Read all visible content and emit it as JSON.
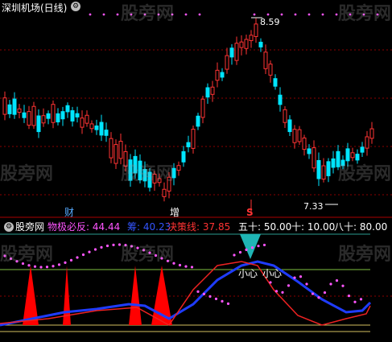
{
  "header": {
    "title": "深圳机场(日线)"
  },
  "price_panel": {
    "high_label": "8.59",
    "low_label": "7.33",
    "markers": [
      "财",
      "增",
      "S"
    ]
  },
  "indicator_panel": {
    "name": "股旁网",
    "labels": [
      "物极必反: 44.44",
      "筹: 40.23",
      "决策线: 37.85",
      "五十: 50.00",
      "十: 10.00",
      "八十: 80.00"
    ],
    "warnings": [
      "小心",
      "小心"
    ]
  },
  "watermark": "股旁网",
  "colors": {
    "up": "#ff3333",
    "down": "#00e5ff",
    "magenta": "#ff55ff",
    "blue": "#1f3cff",
    "grid": "#8b0000"
  },
  "icons": [
    "gear-icon",
    "gear-icon"
  ]
}
